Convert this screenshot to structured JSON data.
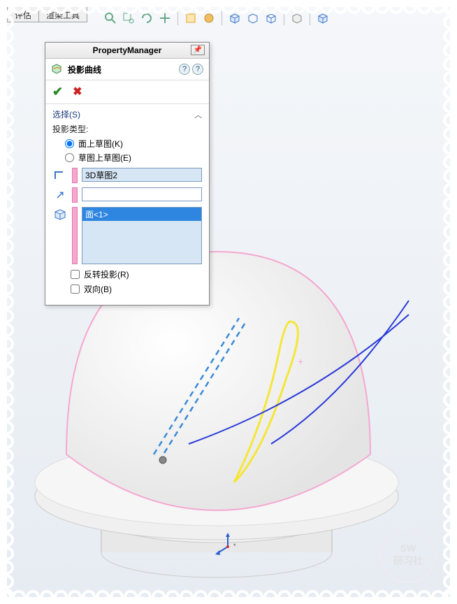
{
  "menubar": {
    "tabs": [
      "评估",
      "渲染工具"
    ]
  },
  "toolbar": {
    "icons": [
      "magnify-icon",
      "rotate-icon",
      "zoom-icon",
      "orbit-icon",
      "pan-icon",
      "section-icon",
      "paint-icon",
      "box1-icon",
      "box2-icon",
      "box3-icon",
      "box4-icon",
      "box5-icon"
    ]
  },
  "panel": {
    "title": "PropertyManager",
    "feature_name": "投影曲线",
    "ok_tooltip": "OK",
    "cancel_tooltip": "Cancel",
    "section": {
      "title": "选择(S)",
      "projection_type_label": "投影类型:",
      "radio_sketch_on_face": "面上草图(K)",
      "radio_sketch_on_sketch": "草图上草图(E)",
      "radio_selected": "sketch_on_face",
      "sketch_field_value": "3D草图2",
      "direction_field_value": "",
      "face_list": [
        "面<1>"
      ],
      "checkbox_reverse": "反转投影(R)",
      "checkbox_reverse_checked": false,
      "checkbox_bidir": "双向(B)",
      "checkbox_bidir_checked": false
    }
  },
  "watermark": {
    "line1": "SW",
    "line2": "研习社"
  }
}
